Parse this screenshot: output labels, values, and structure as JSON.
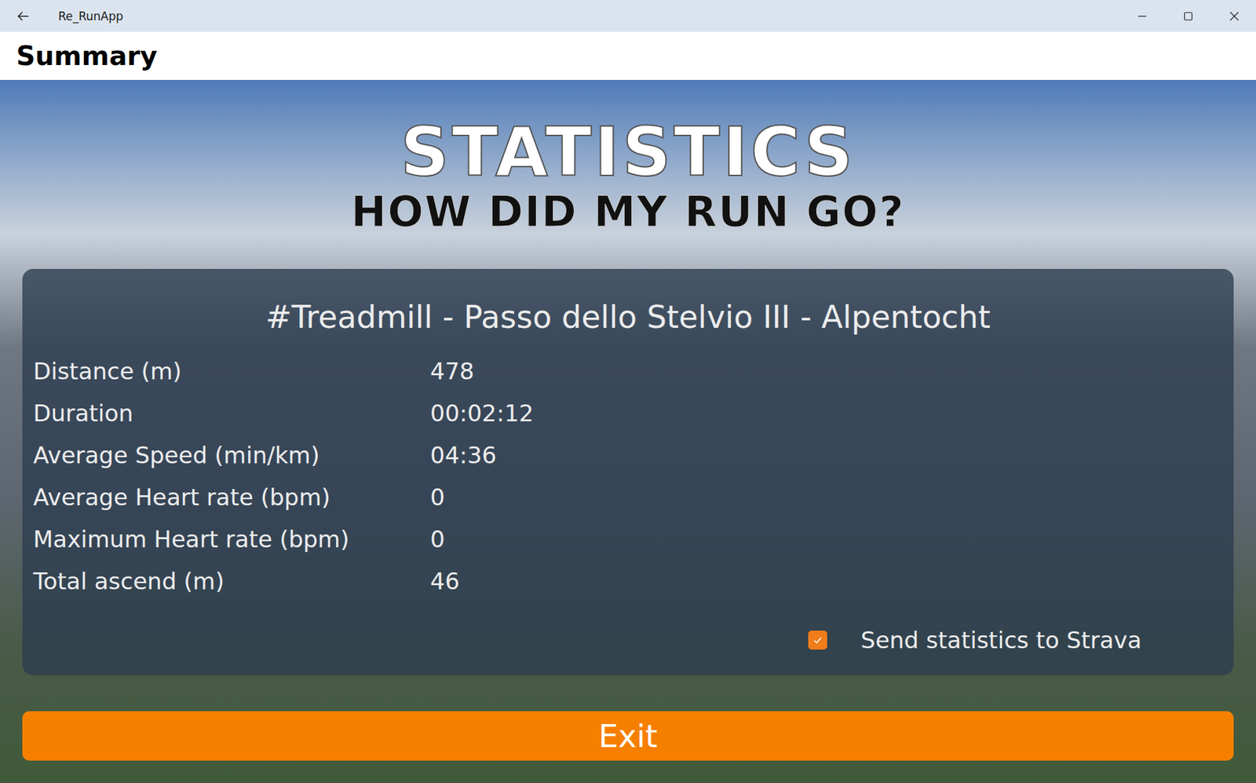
{
  "window": {
    "title": "Re_RunApp"
  },
  "header": {
    "title": "Summary"
  },
  "hero": {
    "title": "STATISTICS",
    "subtitle": "HOW DID MY RUN GO?"
  },
  "run": {
    "name": "#Treadmill - Passo dello Stelvio III - Alpentocht",
    "stats": [
      {
        "label": "Distance (m)",
        "value": "478"
      },
      {
        "label": "Duration",
        "value": "00:02:12"
      },
      {
        "label": "Average Speed (min/km)",
        "value": "04:36"
      },
      {
        "label": "Average Heart rate (bpm)",
        "value": "0"
      },
      {
        "label": "Maximum Heart rate (bpm)",
        "value": "0"
      },
      {
        "label": "Total ascend (m)",
        "value": "46"
      }
    ]
  },
  "strava": {
    "label": "Send statistics to Strava",
    "checked": true
  },
  "buttons": [
    "Exit"
  ]
}
